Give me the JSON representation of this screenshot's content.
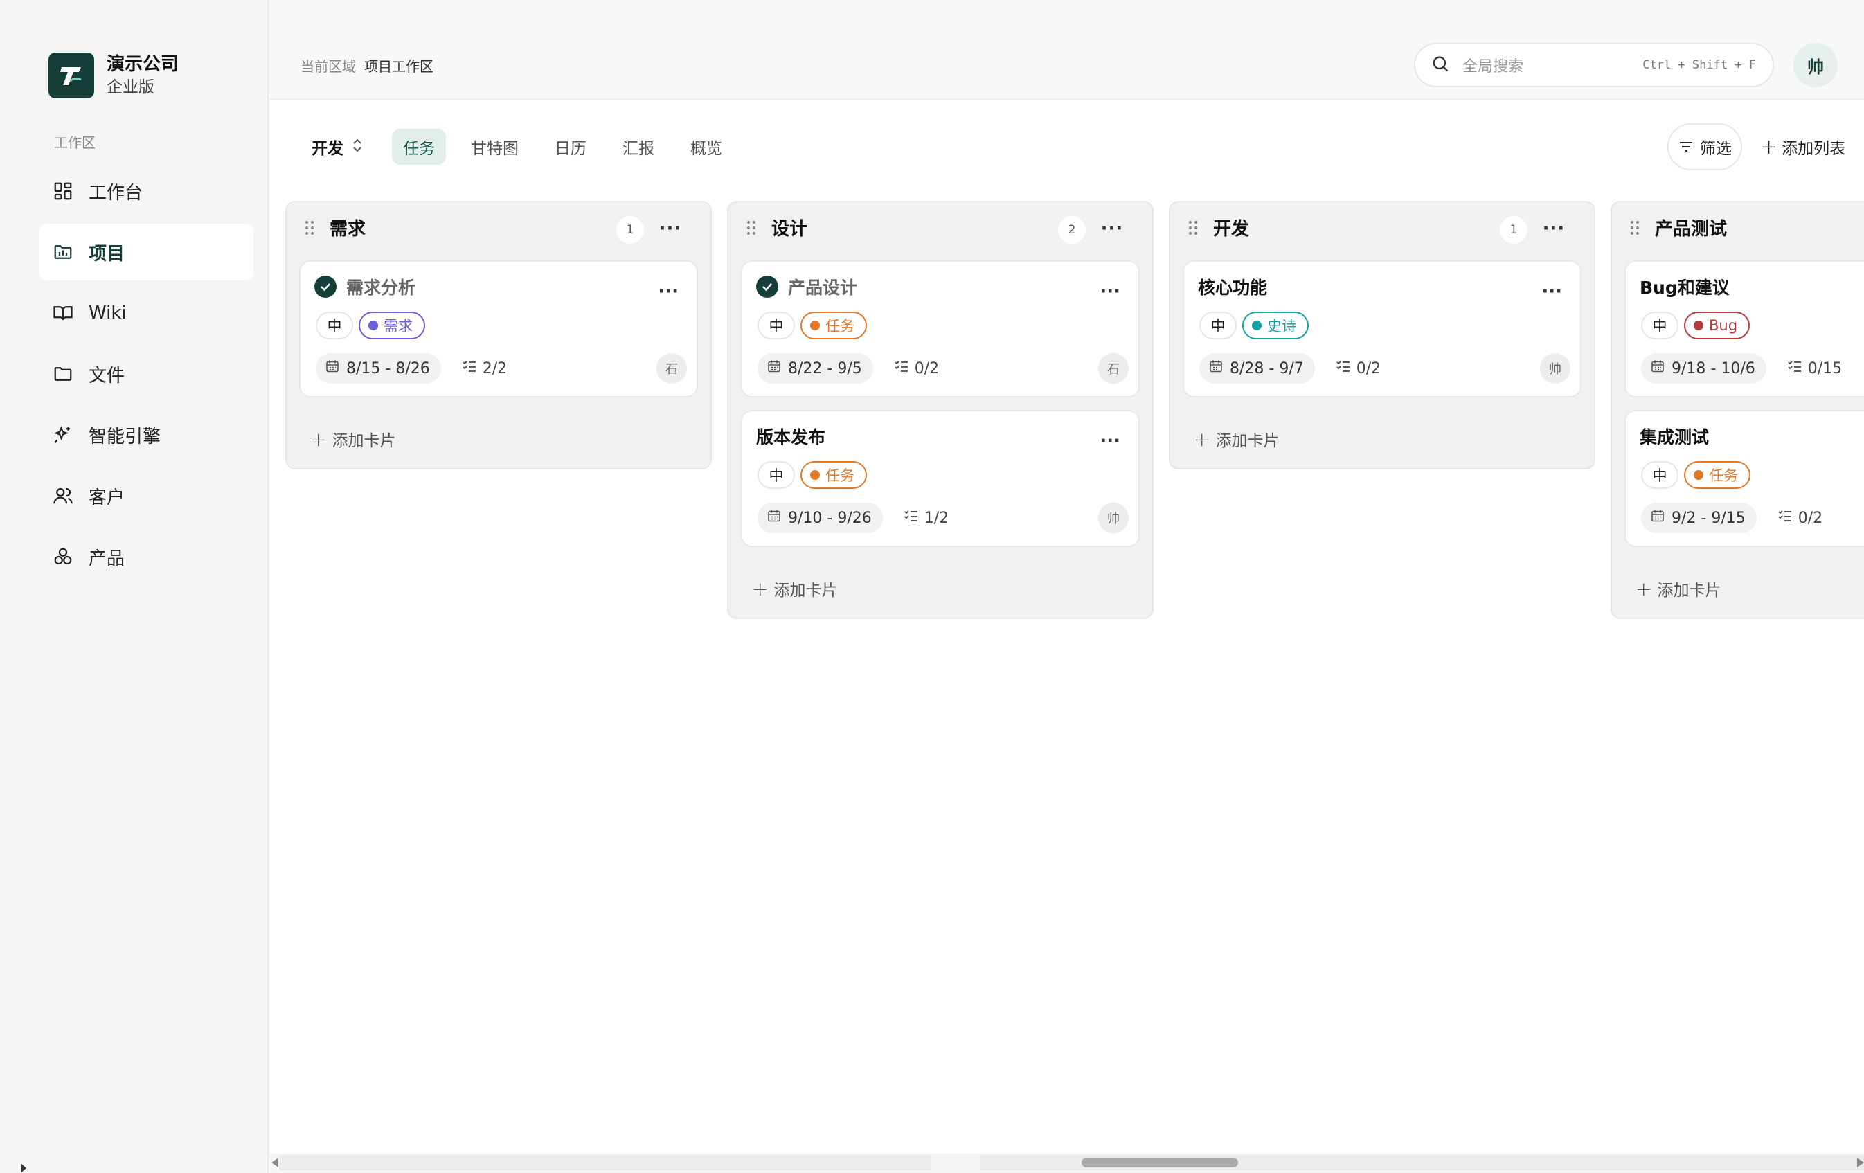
{
  "brand": {
    "name": "演示公司",
    "edition": "企业版"
  },
  "sidebar": {
    "section_label": "工作区",
    "items": [
      {
        "label": "工作台",
        "icon": "dashboard-icon",
        "active": false
      },
      {
        "label": "项目",
        "icon": "folder-project-icon",
        "active": true
      },
      {
        "label": "Wiki",
        "icon": "book-icon",
        "active": false
      },
      {
        "label": "文件",
        "icon": "folder-icon",
        "active": false
      },
      {
        "label": "智能引擎",
        "icon": "sparkles-icon",
        "active": false
      },
      {
        "label": "客户",
        "icon": "users-icon",
        "active": false
      },
      {
        "label": "产品",
        "icon": "products-icon",
        "active": false
      }
    ]
  },
  "header": {
    "breadcrumb_label": "当前区域",
    "breadcrumb_current": "项目工作区",
    "search_placeholder": "全局搜索",
    "search_shortcut": "Ctrl + Shift + F",
    "user_avatar": "帅"
  },
  "viewbar": {
    "project": "开发",
    "tabs": [
      {
        "label": "任务",
        "active": true
      },
      {
        "label": "甘特图",
        "active": false
      },
      {
        "label": "日历",
        "active": false
      },
      {
        "label": "汇报",
        "active": false
      },
      {
        "label": "概览",
        "active": false
      }
    ],
    "filter_label": "筛选",
    "add_list_label": "添加列表"
  },
  "colors": {
    "brand": "#163e38",
    "tag_requirement": "#6b5fd6",
    "tag_task": "#e07a2b",
    "tag_epic": "#14a3a3",
    "tag_bug": "#b23a3a"
  },
  "board": {
    "add_card_label": "添加卡片",
    "columns": [
      {
        "title": "需求",
        "count": "1",
        "cards": [
          {
            "title": "需求分析",
            "done": true,
            "priority": "中",
            "tag": "需求",
            "tag_kind": "requirement",
            "dates": "8/15 - 8/26",
            "subtasks": "2/2",
            "assignee": "石"
          }
        ]
      },
      {
        "title": "设计",
        "count": "2",
        "cards": [
          {
            "title": "产品设计",
            "done": true,
            "priority": "中",
            "tag": "任务",
            "tag_kind": "task",
            "dates": "8/22 - 9/5",
            "subtasks": "0/2",
            "assignee": "石"
          },
          {
            "title": "版本发布",
            "done": false,
            "priority": "中",
            "tag": "任务",
            "tag_kind": "task",
            "dates": "9/10 - 9/26",
            "subtasks": "1/2",
            "assignee": "帅"
          }
        ]
      },
      {
        "title": "开发",
        "count": "1",
        "cards": [
          {
            "title": "核心功能",
            "done": false,
            "priority": "中",
            "tag": "史诗",
            "tag_kind": "epic",
            "dates": "8/28 - 9/7",
            "subtasks": "0/2",
            "assignee": "帅"
          }
        ]
      },
      {
        "title": "产品测试",
        "count": "",
        "cards": [
          {
            "title": "Bug和建议",
            "done": false,
            "priority": "中",
            "tag": "Bug",
            "tag_kind": "bug",
            "dates": "9/18 - 10/6",
            "subtasks": "0/15",
            "assignee": ""
          },
          {
            "title": "集成测试",
            "done": false,
            "priority": "中",
            "tag": "任务",
            "tag_kind": "task",
            "dates": "9/2 - 9/15",
            "subtasks": "0/2",
            "assignee": ""
          }
        ]
      }
    ]
  }
}
